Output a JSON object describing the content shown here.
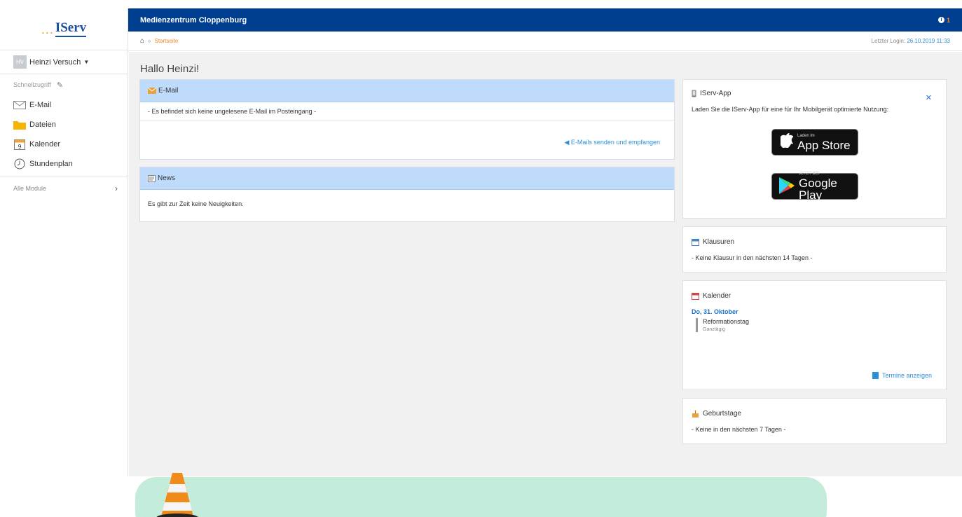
{
  "logo": {
    "dots": "...",
    "word": "IServ"
  },
  "user": {
    "initials": "HV",
    "name": "Heinzi Versuch"
  },
  "sidebar": {
    "quick_label": "Schnellzugriff",
    "items": [
      {
        "label": "E-Mail",
        "icon": "envelope-icon"
      },
      {
        "label": "Dateien",
        "icon": "folder-icon"
      },
      {
        "label": "Kalender",
        "icon": "calendar-icon"
      },
      {
        "label": "Stundenplan",
        "icon": "clock-icon"
      }
    ],
    "all_modules": "Alle Module"
  },
  "topbar": {
    "title": "Medienzentrum Cloppenburg",
    "notification_count": "1"
  },
  "breadcrumb": {
    "current": "Startseite"
  },
  "last_login": {
    "label": "Letzter Login:",
    "value": "26.10.2019 11:33"
  },
  "greeting": "Hallo Heinzi!",
  "email_panel": {
    "title": "E-Mail",
    "message": "- Es befindet sich keine ungelesene E-Mail im Posteingang -",
    "action": "E-Mails senden und empfangen"
  },
  "news_panel": {
    "title": "News",
    "message": "Es gibt zur Zeit keine Neuigkeiten."
  },
  "app_widget": {
    "title": "IServ-App",
    "description": "Laden Sie die IServ-App für eine für Ihr Mobilgerät optimierte Nutzung:",
    "appstore_small": "Laden im",
    "appstore_big": "App Store",
    "googleplay_small": "JETZT BEI",
    "googleplay_big": "Google Play"
  },
  "klausuren_widget": {
    "title": "Klausuren",
    "message": "- Keine Klausur in den nächsten 14 Tagen -"
  },
  "kalender_widget": {
    "title": "Kalender",
    "day": "Do, 31. Oktober",
    "event_title": "Reformationstag",
    "event_sub": "Ganztägig",
    "more": "Termine anzeigen"
  },
  "geburtstage_widget": {
    "title": "Geburtstage",
    "message": "- Keine in den nächsten 7 Tagen -"
  },
  "colors": {
    "topbar": "#003f8f",
    "accent_orange": "#f08a2a",
    "link_blue": "#2d8fd6",
    "panel_head": "#bfdbfb",
    "overlay": "#c4ecdb"
  }
}
